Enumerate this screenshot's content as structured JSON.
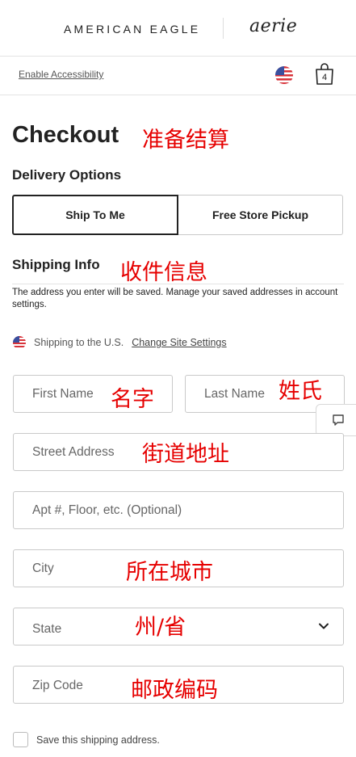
{
  "header": {
    "brand_primary": "AMERICAN EAGLE",
    "brand_secondary": "aerie",
    "accessibility_link": "Enable Accessibility",
    "bag_count": "4"
  },
  "page": {
    "title": "Checkout",
    "title_note": "准备结算"
  },
  "delivery": {
    "heading": "Delivery Options",
    "options": [
      {
        "label": "Ship To Me",
        "selected": true
      },
      {
        "label": "Free Store Pickup",
        "selected": false
      }
    ]
  },
  "shipping": {
    "heading": "Shipping Info",
    "heading_note": "收件信息",
    "info_text": "The address you enter will be saved. Manage your saved addresses in account settings.",
    "location_text": "Shipping to the U.S.",
    "change_link": "Change Site Settings",
    "fields": {
      "first_name": {
        "placeholder": "First Name",
        "note": "名字"
      },
      "last_name": {
        "placeholder": "Last Name",
        "note": "姓氏"
      },
      "street": {
        "placeholder": "Street Address",
        "note": "街道地址"
      },
      "apt": {
        "placeholder": "Apt #, Floor, etc. (Optional)"
      },
      "city": {
        "placeholder": "City",
        "note": "所在城市"
      },
      "state": {
        "placeholder": "State",
        "note": "州/省"
      },
      "zip": {
        "placeholder": "Zip Code",
        "note": "邮政编码"
      }
    },
    "save_label": "Save this shipping address."
  },
  "colors": {
    "annotation": "#e60000",
    "text": "#222222",
    "border": "#c9c9c9"
  }
}
